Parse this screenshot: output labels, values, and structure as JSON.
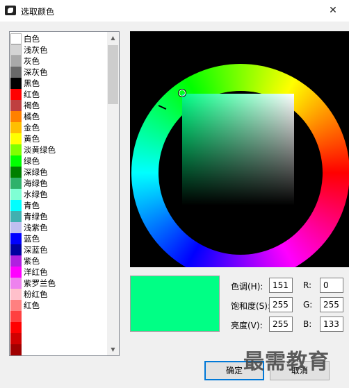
{
  "window": {
    "title": "选取颜色",
    "close_glyph": "✕",
    "app_icon": "rhino-icon"
  },
  "color_list": {
    "items": [
      {
        "label": "白色",
        "color": "#ffffff"
      },
      {
        "label": "浅灰色",
        "color": "#d4d4d4"
      },
      {
        "label": "灰色",
        "color": "#a9a9a9"
      },
      {
        "label": "深灰色",
        "color": "#696969"
      },
      {
        "label": "黑色",
        "color": "#000000"
      },
      {
        "label": "红色",
        "color": "#ff0000"
      },
      {
        "label": "褐色",
        "color": "#bf3f3f"
      },
      {
        "label": "橘色",
        "color": "#ff8000"
      },
      {
        "label": "金色",
        "color": "#ffbf00"
      },
      {
        "label": "黄色",
        "color": "#ffff00"
      },
      {
        "label": "淡黄绿色",
        "color": "#80ff00"
      },
      {
        "label": "绿色",
        "color": "#00ff00"
      },
      {
        "label": "深绿色",
        "color": "#007f00"
      },
      {
        "label": "海绿色",
        "color": "#2fb26b"
      },
      {
        "label": "水绿色",
        "color": "#7fffd4"
      },
      {
        "label": "青色",
        "color": "#00ffff"
      },
      {
        "label": "青绿色",
        "color": "#40b0b0"
      },
      {
        "label": "浅紫色",
        "color": "#bfbff0"
      },
      {
        "label": "蓝色",
        "color": "#0000ff"
      },
      {
        "label": "深蓝色",
        "color": "#0000a0"
      },
      {
        "label": "紫色",
        "color": "#b020e0"
      },
      {
        "label": "洋红色",
        "color": "#ff00ff"
      },
      {
        "label": "紫罗兰色",
        "color": "#ee82ee"
      },
      {
        "label": "粉红色",
        "color": "#ffc0cb"
      },
      {
        "label": "红色",
        "color": "#ff8080"
      },
      {
        "label": "",
        "color": "#ff4040"
      },
      {
        "label": "",
        "color": "#ff0000"
      },
      {
        "label": "",
        "color": "#d00000"
      },
      {
        "label": "",
        "color": "#a00000"
      },
      {
        "label": "",
        "color": "#800000"
      }
    ],
    "scroll_up_glyph": "▲",
    "scroll_down_glyph": "▼"
  },
  "preview_color": "#00ff85",
  "fields": {
    "hue": {
      "label": "色调(H):",
      "value": "151"
    },
    "saturation": {
      "label": "饱和度(S):",
      "value": "255"
    },
    "value": {
      "label": "亮度(V):",
      "value": "255"
    },
    "red": {
      "label": "R:",
      "value": "0"
    },
    "green": {
      "label": "G:",
      "value": "255"
    },
    "blue": {
      "label": "B:",
      "value": "133"
    }
  },
  "buttons": {
    "ok": "确定",
    "cancel": "取消"
  },
  "watermark": "最需教育"
}
